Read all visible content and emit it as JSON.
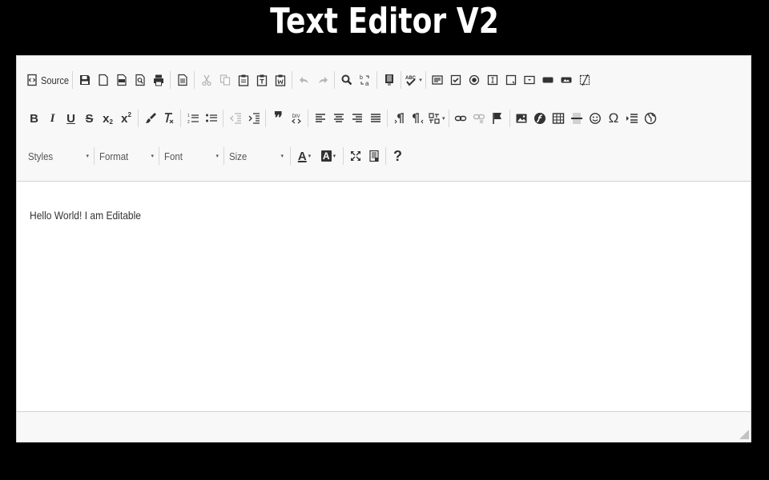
{
  "page": {
    "title": "Text Editor V2"
  },
  "toolbar": {
    "source_label": "Source",
    "bold": "B",
    "italic": "I",
    "underline": "U",
    "strike": "S",
    "subscript": "x",
    "subscript_mark": "2",
    "superscript": "x",
    "superscript_mark": "2",
    "styles_label": "Styles",
    "format_label": "Format",
    "font_label": "Font",
    "size_label": "Size",
    "text_color": "A",
    "bg_color": "A",
    "help": "?",
    "omega": "Ω",
    "quote": "❞",
    "dropdown_caret": "▾"
  },
  "content": {
    "text": "Hello World! I am Editable"
  },
  "colors": {
    "background": "#000000",
    "toolbar": "#f8f8f8",
    "border": "#d1d1d1",
    "icon": "#333333"
  }
}
